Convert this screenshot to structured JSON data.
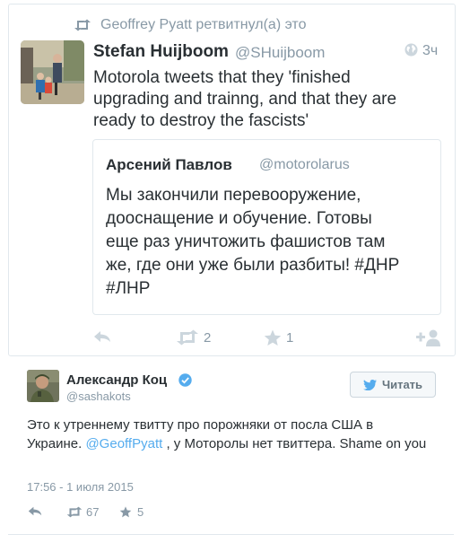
{
  "retweet": {
    "header": "Geoffrey Pyatt ретвитнул(а) это",
    "author_name": "Stefan Huijboom",
    "author_handle": "@SHuijboom",
    "time": "3ч",
    "text_lines": [
      "Motorola tweets that they 'finished",
      "upgrading and trainng, and that they are",
      "ready to destroy the fascists'"
    ],
    "quoted": {
      "author_name": "Арсений Павлов",
      "author_handle": "@motorolarus",
      "text_lines": [
        "Мы закончили перевооружение,",
        "дооснащение и обучение. Готовы",
        "еще раз уничтожить фашистов там",
        "же, где они уже были разбиты! #ДНР",
        "#ЛНР"
      ]
    },
    "actions": {
      "retweets": "2",
      "favorites": "1"
    }
  },
  "tweet": {
    "author_name": "Александр Коц",
    "author_handle": "@sashakots",
    "follow_label": "Читать",
    "text_part1": "Это к утреннему твитту про порожняки от посла США в Украине. ",
    "mention": "@GeoffPyatt",
    "text_part2": " , у Моторолы нет твиттера. Shame on you",
    "date": "17:56 - 1 июля 2015",
    "actions": {
      "retweets": "67",
      "favorites": "5"
    }
  },
  "colors": {
    "accent": "#55acee",
    "muted": "#8899a6",
    "text": "#292f33",
    "border": "#e1e8ed"
  },
  "icons": [
    "retweet-icon",
    "globe-icon",
    "reply-icon",
    "star-icon",
    "follow-icon",
    "verified-icon",
    "twitter-bird-icon"
  ]
}
